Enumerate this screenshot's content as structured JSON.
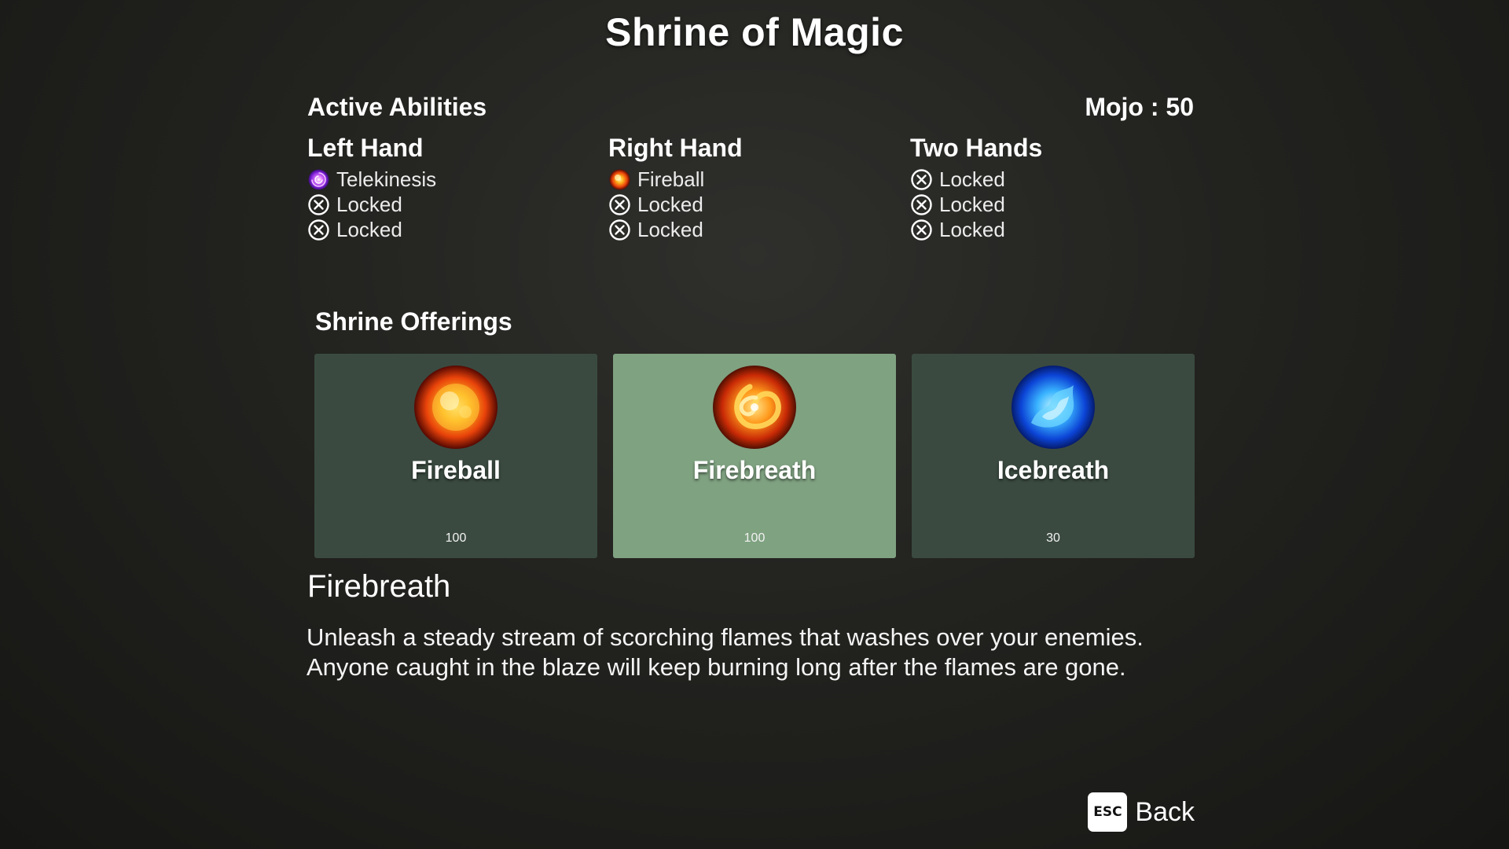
{
  "title": "Shrine of Magic",
  "active_abilities": {
    "heading": "Active Abilities",
    "mojo_label": "Mojo : 50",
    "hands": [
      {
        "title": "Left Hand",
        "slots": [
          {
            "label": "Telekinesis",
            "icon": "telekinesis-icon"
          },
          {
            "label": "Locked",
            "icon": "locked-icon"
          },
          {
            "label": "Locked",
            "icon": "locked-icon"
          }
        ]
      },
      {
        "title": "Right Hand",
        "slots": [
          {
            "label": "Fireball",
            "icon": "fireball-icon"
          },
          {
            "label": "Locked",
            "icon": "locked-icon"
          },
          {
            "label": "Locked",
            "icon": "locked-icon"
          }
        ]
      },
      {
        "title": "Two Hands",
        "slots": [
          {
            "label": "Locked",
            "icon": "locked-icon"
          },
          {
            "label": "Locked",
            "icon": "locked-icon"
          },
          {
            "label": "Locked",
            "icon": "locked-icon"
          }
        ]
      }
    ]
  },
  "offerings": {
    "heading": "Shrine Offerings",
    "selected_index": 1,
    "items": [
      {
        "name": "Fireball",
        "cost": "100",
        "icon": "fireball-orb-icon"
      },
      {
        "name": "Firebreath",
        "cost": "100",
        "icon": "firebreath-orb-icon"
      },
      {
        "name": "Icebreath",
        "cost": "30",
        "icon": "icebreath-orb-icon"
      }
    ]
  },
  "detail": {
    "name": "Firebreath",
    "description_line1": "Unleash a steady stream of scorching flames that washes over your enemies.",
    "description_line2": "Anyone caught in the blaze will keep burning long after the flames are gone."
  },
  "footer": {
    "key_label": "ESC",
    "back_label": "Back"
  },
  "colors": {
    "card_default": "#3a4a40",
    "card_selected": "#7fa281",
    "background": "#22221f"
  }
}
